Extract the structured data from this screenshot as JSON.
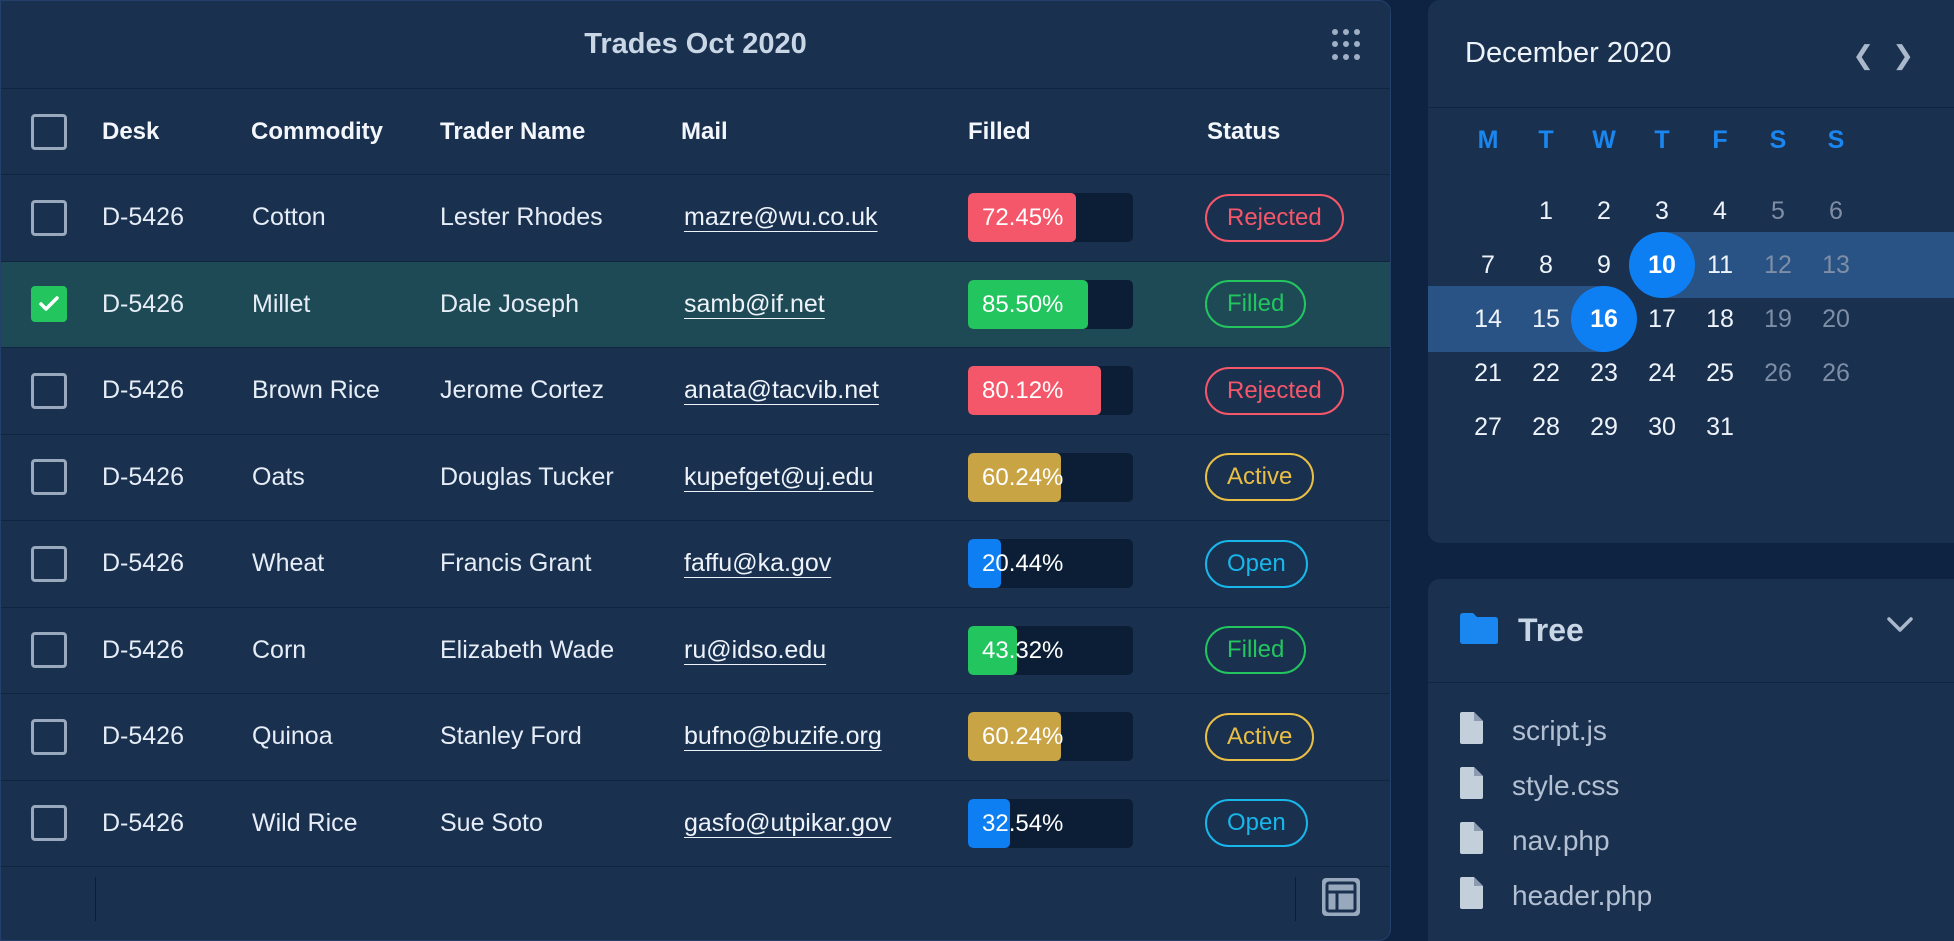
{
  "trades": {
    "title": "Trades Oct 2020",
    "columns": [
      "Desk",
      "Commodity",
      "Trader Name",
      "Mail",
      "Filled",
      "Status"
    ],
    "rows": [
      {
        "desk": "D-5426",
        "commodity": "Cotton",
        "trader": "Lester Rhodes",
        "mail": "mazre@wu.co.uk",
        "filled": "72.45%",
        "filled_value": 0.6545,
        "fill_color": "#f4576a",
        "status": "Rejected",
        "status_kind": "rejected",
        "checked": false
      },
      {
        "desk": "D-5426",
        "commodity": "Millet",
        "trader": "Dale Joseph",
        "mail": "samb@if.net",
        "filled": "85.50%",
        "filled_value": 0.7273,
        "fill_color": "#22c55e",
        "status": "Filled",
        "status_kind": "filled",
        "checked": true
      },
      {
        "desk": "D-5426",
        "commodity": "Brown Rice",
        "trader": "Jerome Cortez",
        "mail": "anata@tacvib.net",
        "filled": "80.12%",
        "filled_value": 0.8061,
        "fill_color": "#f4576a",
        "status": "Rejected",
        "status_kind": "rejected",
        "checked": false
      },
      {
        "desk": "D-5426",
        "commodity": "Oats",
        "trader": "Douglas Tucker",
        "mail": "kupefget@uj.edu",
        "filled": "60.24%",
        "filled_value": 0.5636,
        "fill_color": "#c9a445",
        "status": "Active",
        "status_kind": "active",
        "checked": false
      },
      {
        "desk": "D-5426",
        "commodity": "Wheat",
        "trader": "Francis Grant",
        "mail": "faffu@ka.gov",
        "filled": "20.44%",
        "filled_value": 0.2,
        "fill_color": "#0d7ff2",
        "status": "Open",
        "status_kind": "open",
        "checked": false
      },
      {
        "desk": "D-5426",
        "commodity": "Corn",
        "trader": "Elizabeth Wade",
        "mail": "ru@idso.edu",
        "filled": "43.32%",
        "filled_value": 0.297,
        "fill_color": "#22c55e",
        "status": "Filled",
        "status_kind": "filled",
        "checked": false
      },
      {
        "desk": "D-5426",
        "commodity": "Quinoa",
        "trader": "Stanley Ford",
        "mail": "bufno@buzife.org",
        "filled": "60.24%",
        "filled_value": 0.5636,
        "fill_color": "#c9a445",
        "status": "Active",
        "status_kind": "active",
        "checked": false
      },
      {
        "desk": "D-5426",
        "commodity": "Wild Rice",
        "trader": "Sue Soto",
        "mail": "gasfo@utpikar.gov",
        "filled": "32.54%",
        "filled_value": 0.2545,
        "fill_color": "#0d7ff2",
        "status": "Open",
        "status_kind": "open",
        "checked": false
      }
    ]
  },
  "calendar": {
    "month": "December 2020",
    "weekdays": [
      "M",
      "T",
      "W",
      "T",
      "F",
      "S",
      "S"
    ],
    "weeks": [
      [
        "",
        "1",
        "2",
        "3",
        "4",
        "5",
        "6"
      ],
      [
        "7",
        "8",
        "9",
        "10",
        "11",
        "12",
        "13"
      ],
      [
        "14",
        "15",
        "16",
        "17",
        "18",
        "19",
        "20"
      ],
      [
        "21",
        "22",
        "23",
        "24",
        "25",
        "26",
        "26"
      ],
      [
        "27",
        "28",
        "29",
        "30",
        "31",
        "",
        ""
      ]
    ],
    "range_start": "10",
    "range_end": "16"
  },
  "tree": {
    "title": "Tree",
    "files": [
      "script.js",
      "style.css",
      "nav.php",
      "header.php"
    ]
  }
}
